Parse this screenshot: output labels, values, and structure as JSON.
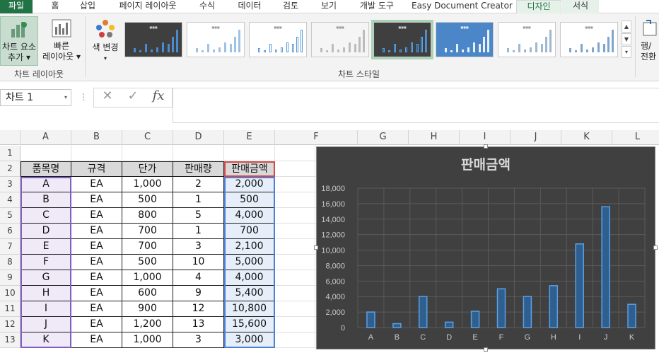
{
  "tabs": [
    "파일",
    "홈",
    "삽입",
    "페이지 레이아웃",
    "수식",
    "데이터",
    "검토",
    "보기",
    "개발 도구",
    "Easy Document Creator",
    "디자인",
    "서식"
  ],
  "ribbon": {
    "add_element_line1": "차트 요소",
    "add_element_line2": "추가",
    "quick_layout_line1": "빠른",
    "quick_layout_line2": "레이아웃",
    "change_color": "색 변경",
    "group_chart_layouts": "차트 레이아웃",
    "group_chart_styles": "차트 스타일",
    "switch_row_col_line1": "행/",
    "switch_row_col_line2": "전환"
  },
  "formula_bar": {
    "name_box": "차트 1",
    "cancel_glyph": "✕",
    "enter_glyph": "✓",
    "fx_glyph": "fx",
    "formula": ""
  },
  "columns": [
    "A",
    "B",
    "C",
    "D",
    "E",
    "F",
    "G",
    "H",
    "I",
    "J",
    "K",
    "L"
  ],
  "rows": [
    "1",
    "2",
    "3",
    "4",
    "5",
    "6",
    "7",
    "8",
    "9",
    "10",
    "11",
    "12",
    "13"
  ],
  "table": {
    "headers": [
      "품목명",
      "규격",
      "단가",
      "판매량",
      "판매금액"
    ],
    "rows": [
      [
        "A",
        "EA",
        "1,000",
        "2",
        "2,000"
      ],
      [
        "B",
        "EA",
        "500",
        "1",
        "500"
      ],
      [
        "C",
        "EA",
        "800",
        "5",
        "4,000"
      ],
      [
        "D",
        "EA",
        "700",
        "1",
        "700"
      ],
      [
        "E",
        "EA",
        "700",
        "3",
        "2,100"
      ],
      [
        "F",
        "EA",
        "500",
        "10",
        "5,000"
      ],
      [
        "G",
        "EA",
        "1,000",
        "4",
        "4,000"
      ],
      [
        "H",
        "EA",
        "600",
        "9",
        "5,400"
      ],
      [
        "I",
        "EA",
        "900",
        "12",
        "10,800"
      ],
      [
        "J",
        "EA",
        "1,200",
        "13",
        "15,600"
      ],
      [
        "K",
        "EA",
        "1,000",
        "3",
        "3,000"
      ]
    ]
  },
  "chart_data": {
    "type": "bar",
    "title": "판매금액",
    "categories": [
      "A",
      "B",
      "C",
      "D",
      "E",
      "F",
      "G",
      "H",
      "I",
      "J",
      "K"
    ],
    "values": [
      2000,
      500,
      4000,
      700,
      2100,
      5000,
      4000,
      5400,
      10800,
      15600,
      3000
    ],
    "y_ticks": [
      "0",
      "2,000",
      "4,000",
      "6,000",
      "8,000",
      "10,000",
      "12,000",
      "14,000",
      "16,000",
      "18,000"
    ],
    "ylim": [
      0,
      18000
    ],
    "grid": true,
    "legend": "none",
    "colors": {
      "background": "#404040",
      "bar_fill": "#2f5f8f",
      "bar_edge": "#5aa0e6",
      "grid": "#5a5a5a",
      "text": "#c8c8c8"
    }
  },
  "colors": {
    "accent": "#217346",
    "selected_range_a": "#7f5fbf",
    "selected_range_e": "#4a7fd6",
    "highlight_header": "#d04a4a"
  }
}
